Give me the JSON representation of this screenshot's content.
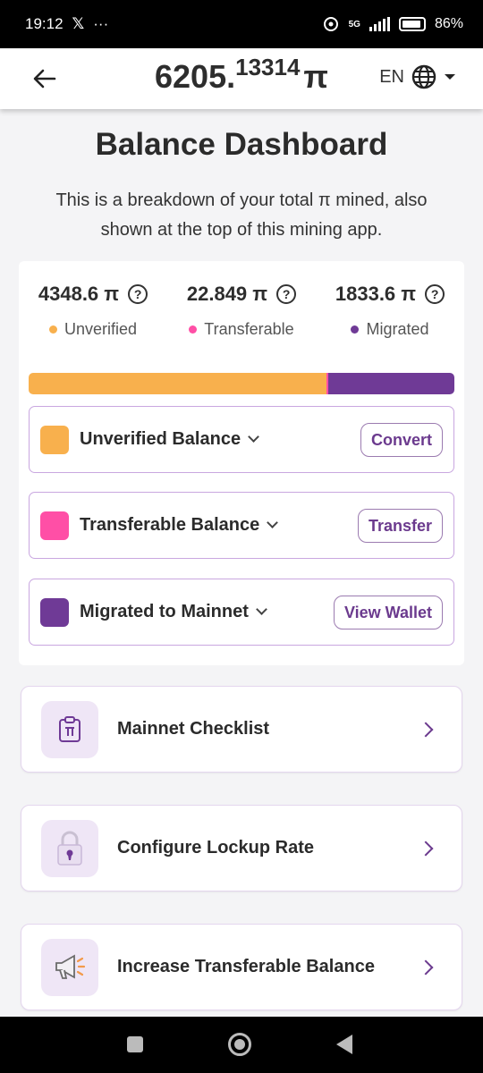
{
  "status_bar": {
    "time": "19:12",
    "x_logo": "𝕏",
    "more": "···",
    "battery": "86",
    "network": "5G"
  },
  "header": {
    "balance_int": "6205.",
    "balance_dec": "13314",
    "pi": "π",
    "lang": "EN"
  },
  "title": "Balance Dashboard",
  "subtitle": "This is a breakdown of your total π mined, also shown at the top of this mining app.",
  "stats": [
    {
      "value": "4348.6 π",
      "label": "Unverified",
      "color": "#f8b04d"
    },
    {
      "value": "22.849 π",
      "label": "Transferable",
      "color": "#ff4fa6"
    },
    {
      "value": "1833.6 π",
      "label": "Migrated",
      "color": "#6f3a96"
    }
  ],
  "bar_shares": [
    0.7,
    0.004,
    0.296
  ],
  "balances": [
    {
      "name": "Unverified Balance",
      "action": "Convert",
      "color": "#f8b04d"
    },
    {
      "name": "Transferable Balance",
      "action": "Transfer",
      "color": "#ff4fa6"
    },
    {
      "name": "Migrated to Mainnet",
      "action": "View Wallet",
      "color": "#6f3a96"
    }
  ],
  "nav": [
    {
      "label": "Mainnet Checklist",
      "icon": "clipboard-pi-icon"
    },
    {
      "label": "Configure Lockup Rate",
      "icon": "padlock-icon"
    },
    {
      "label": "Increase Transferable Balance",
      "icon": "megaphone-icon"
    }
  ],
  "question_mark": "?"
}
